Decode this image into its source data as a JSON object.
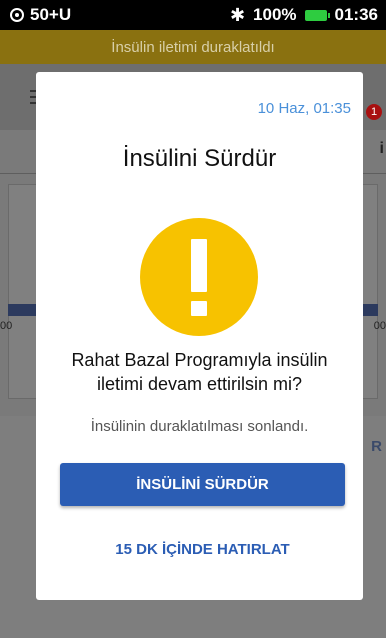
{
  "status_bar": {
    "left_text": "50+U",
    "battery_percent": "100%",
    "time": "01:36",
    "icons": [
      "pod-status-icon",
      "bluetooth-icon",
      "battery-icon"
    ],
    "battery_color": "#2ecc40"
  },
  "banner": {
    "text": "İnsülin iletimi duraklatıldı",
    "color": "#8a7110"
  },
  "background": {
    "notification_count": "1",
    "tab_fragment": "i",
    "label_left": "00",
    "label_right": "00",
    "link_fragment": "R"
  },
  "dialog": {
    "timestamp": "10 Haz, 01:35",
    "title": "İnsülini Sürdür",
    "icon": "warning-exclamation-icon",
    "icon_color": "#f7c200",
    "question": "Rahat Bazal Programıyla insülin iletimi devam ettirilsin mi?",
    "subtext": "İnsülinin duraklatılması sonlandı.",
    "primary_button": "İNSÜLİNİ SÜRDÜR",
    "secondary_button": "15 DK İÇİNDE HATIRLAT",
    "accent_color": "#2b5db4"
  }
}
